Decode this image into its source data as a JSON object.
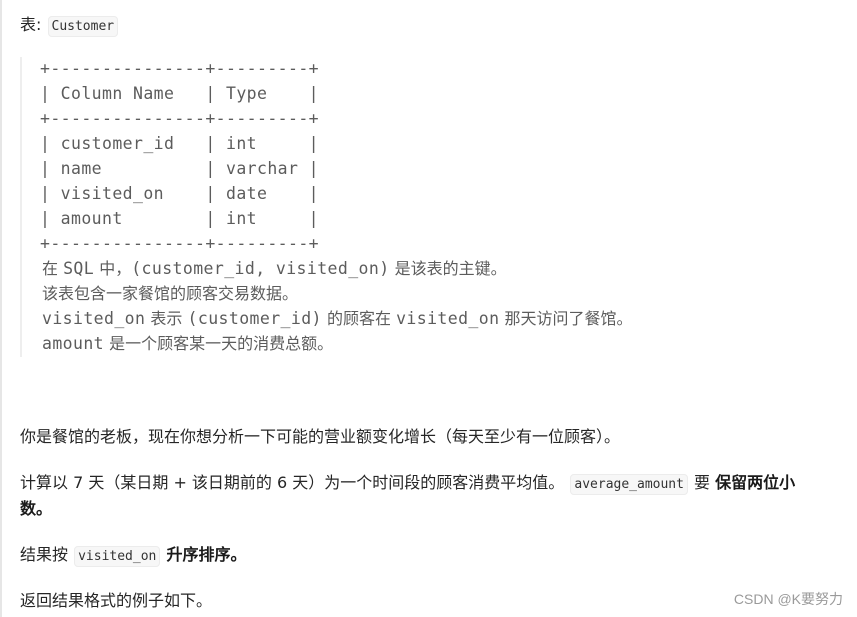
{
  "header": {
    "label": "表:",
    "table_name": "Customer"
  },
  "schema": {
    "border_top": "+---------------+---------+",
    "header_row": "| Column Name   | Type    |",
    "border_mid": "+---------------+---------+",
    "rows": [
      "| customer_id   | int     |",
      "| name          | varchar |",
      "| visited_on    | date    |",
      "| amount        | int     |"
    ],
    "border_bottom": "+---------------+---------+",
    "columns": [
      "Column Name",
      "Type"
    ],
    "fields": [
      {
        "name": "customer_id",
        "type": "int"
      },
      {
        "name": "name",
        "type": "varchar"
      },
      {
        "name": "visited_on",
        "type": "date"
      },
      {
        "name": "amount",
        "type": "int"
      }
    ]
  },
  "notes": {
    "line1": {
      "a": "在 ",
      "b": "SQL",
      "c": " 中，",
      "d": "(customer_id, visited_on)",
      "e": " 是该表的主键。"
    },
    "line2": "该表包含一家餐馆的顾客交易数据。",
    "line3": {
      "a": "visited_on",
      "b": " 表示 ",
      "c": "(customer_id)",
      "d": " 的顾客在 ",
      "e": "visited_on",
      "f": " 那天访问了餐馆。"
    },
    "line4": {
      "a": "amount",
      "b": " 是一个顾客某一天的消费总额。"
    }
  },
  "body": {
    "p1": "你是餐馆的老板，现在你想分析一下可能的营业额变化增长（每天至少有一位顾客）。",
    "p2_text": "计算以 7 天（某日期 + 该日期前的 6 天）为一个时间段的顾客消费平均值。",
    "p2_code": "average_amount",
    "p2_mid": " 要 ",
    "p2_bold_1": "保留两位小",
    "p2_bold_2": "数。",
    "p3_text": "结果按 ",
    "p3_code": "visited_on",
    "p3_bold": "升序排序。",
    "p4": "返回结果格式的例子如下。"
  },
  "watermark": "CSDN @K要努力"
}
